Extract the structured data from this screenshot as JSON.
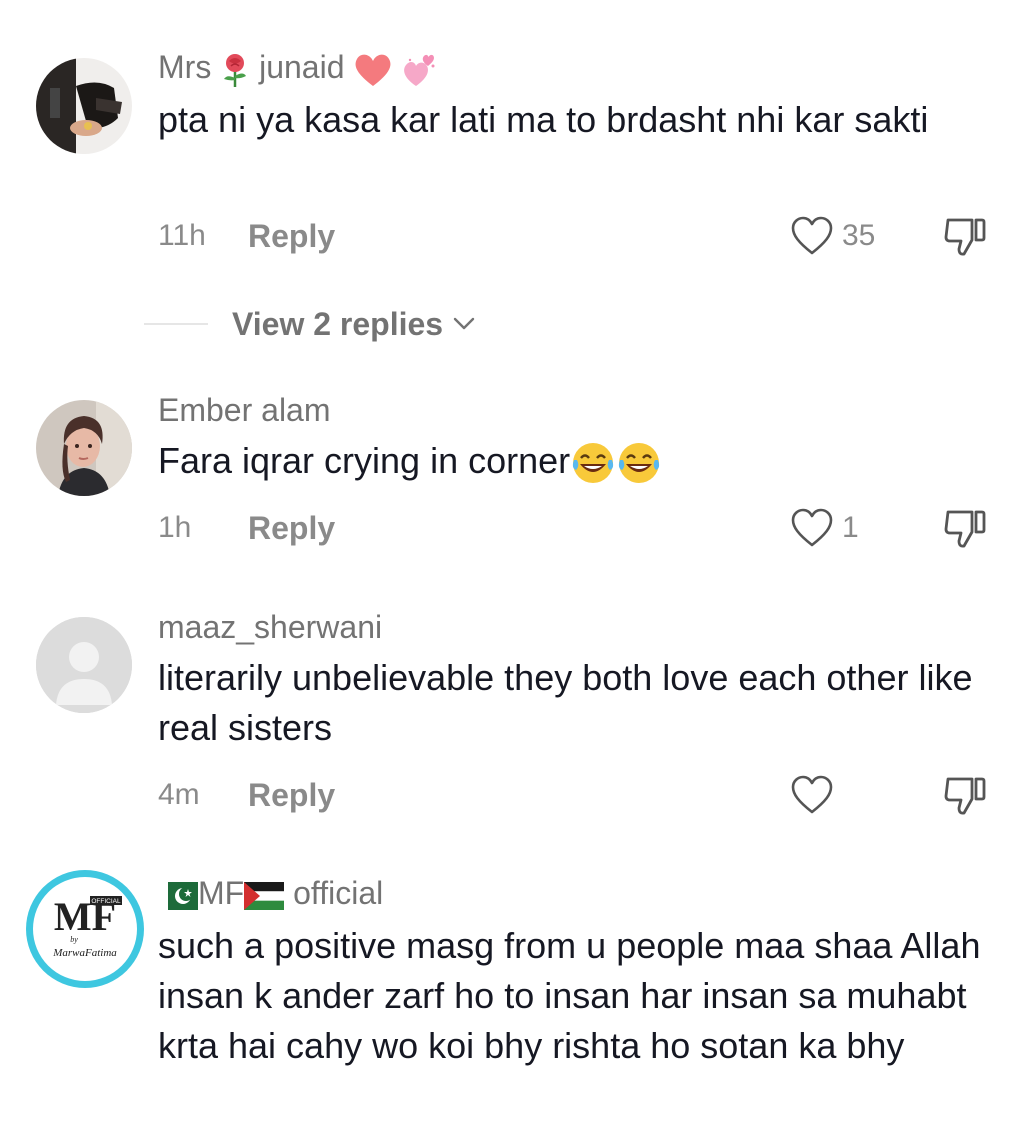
{
  "comments": [
    {
      "username_parts": [
        "Mrs",
        "junaid"
      ],
      "text": "pta ni ya kasa kar lati ma to brdasht nhi kar sakti",
      "time": "11h",
      "reply_label": "Reply",
      "likes": "35",
      "view_replies": "View 2 replies"
    },
    {
      "username": "Ember alam",
      "text": "Fara iqrar crying in corner",
      "time": "1h",
      "reply_label": "Reply",
      "likes": "1"
    },
    {
      "username": "maaz_sherwani",
      "text": "literarily unbelievable they both love each other like real sisters",
      "time": "4m",
      "reply_label": "Reply",
      "likes": ""
    },
    {
      "username_parts": [
        "MF",
        "official"
      ],
      "avatar_text": {
        "brand": "MF",
        "official": "OFFICIAL",
        "by": "by",
        "name": "MarwaFatima"
      },
      "text": "such a positive masg from u people maa shaa Allah insan k ander zarf ho to insan har insan sa muhabt krta hai cahy wo koi bhy rishta ho sotan ka bhy"
    }
  ],
  "colors": {
    "text": "#161823",
    "muted": "#8a8a8a",
    "username": "#737373",
    "avatar_ring": "#3ec7e0"
  },
  "icons": [
    "heart-outline-icon",
    "thumbs-down-icon",
    "chevron-down-icon",
    "rose-emoji",
    "heart-emoji",
    "sparkling-hearts-emoji",
    "laughing-tears-emoji",
    "pakistan-flag-icon",
    "palestine-flag-icon"
  ]
}
